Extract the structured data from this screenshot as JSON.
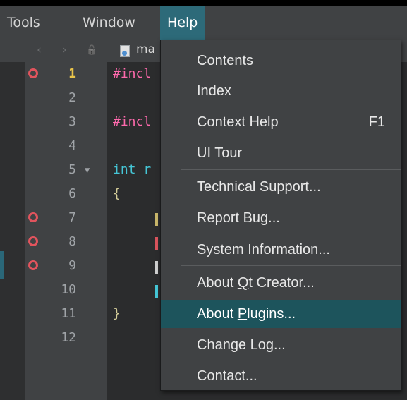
{
  "menubar": {
    "items": [
      {
        "first": "T",
        "rest": "ools"
      },
      {
        "first": "W",
        "rest": "indow"
      },
      {
        "first": "H",
        "rest": "elp"
      }
    ]
  },
  "toolbar": {
    "back_glyph": "‹",
    "forward_glyph": "›",
    "lock_glyph": "🔓",
    "file_name": "ma"
  },
  "gutter": {
    "line_numbers": [
      "1",
      "2",
      "3",
      "4",
      "5",
      "6",
      "7",
      "8",
      "9",
      "10",
      "11",
      "12"
    ],
    "breakpoints": [
      1,
      7,
      8,
      9
    ],
    "fold_marker": "▼"
  },
  "code": {
    "lines": [
      {
        "text": "#incl",
        "kind": "pre"
      },
      {
        "text": "",
        "kind": "plain"
      },
      {
        "text": "#incl",
        "kind": "pre"
      },
      {
        "text": "",
        "kind": "plain"
      },
      {
        "text": "int r",
        "kind": "kw"
      },
      {
        "text": "{",
        "kind": "plain"
      },
      {
        "text": "",
        "kind": "plain"
      },
      {
        "text": "",
        "kind": "plain"
      },
      {
        "text": "",
        "kind": "plain"
      },
      {
        "text": "",
        "kind": "plain"
      },
      {
        "text": "}",
        "kind": "plain"
      },
      {
        "text": "",
        "kind": "plain"
      }
    ]
  },
  "help_menu": {
    "contents": "Contents",
    "index": "Index",
    "context_help": "Context Help",
    "context_help_shortcut": "F1",
    "ui_tour": "UI Tour",
    "technical_support": "Technical Support...",
    "report_bug": "Report Bug...",
    "system_information": "System Information...",
    "about_qt_creator_pre": "About ",
    "about_qt_creator_ul": "Q",
    "about_qt_creator_post": "t Creator...",
    "about_plugins_pre": "About ",
    "about_plugins_ul": "P",
    "about_plugins_post": "lugins...",
    "change_log": "Change Log...",
    "contact": "Contact..."
  },
  "colors": {
    "accent": "#2d6a79",
    "highlight": "#1d545c",
    "breakpoint": "#e1545d",
    "current_line_number": "#e8c34a"
  }
}
